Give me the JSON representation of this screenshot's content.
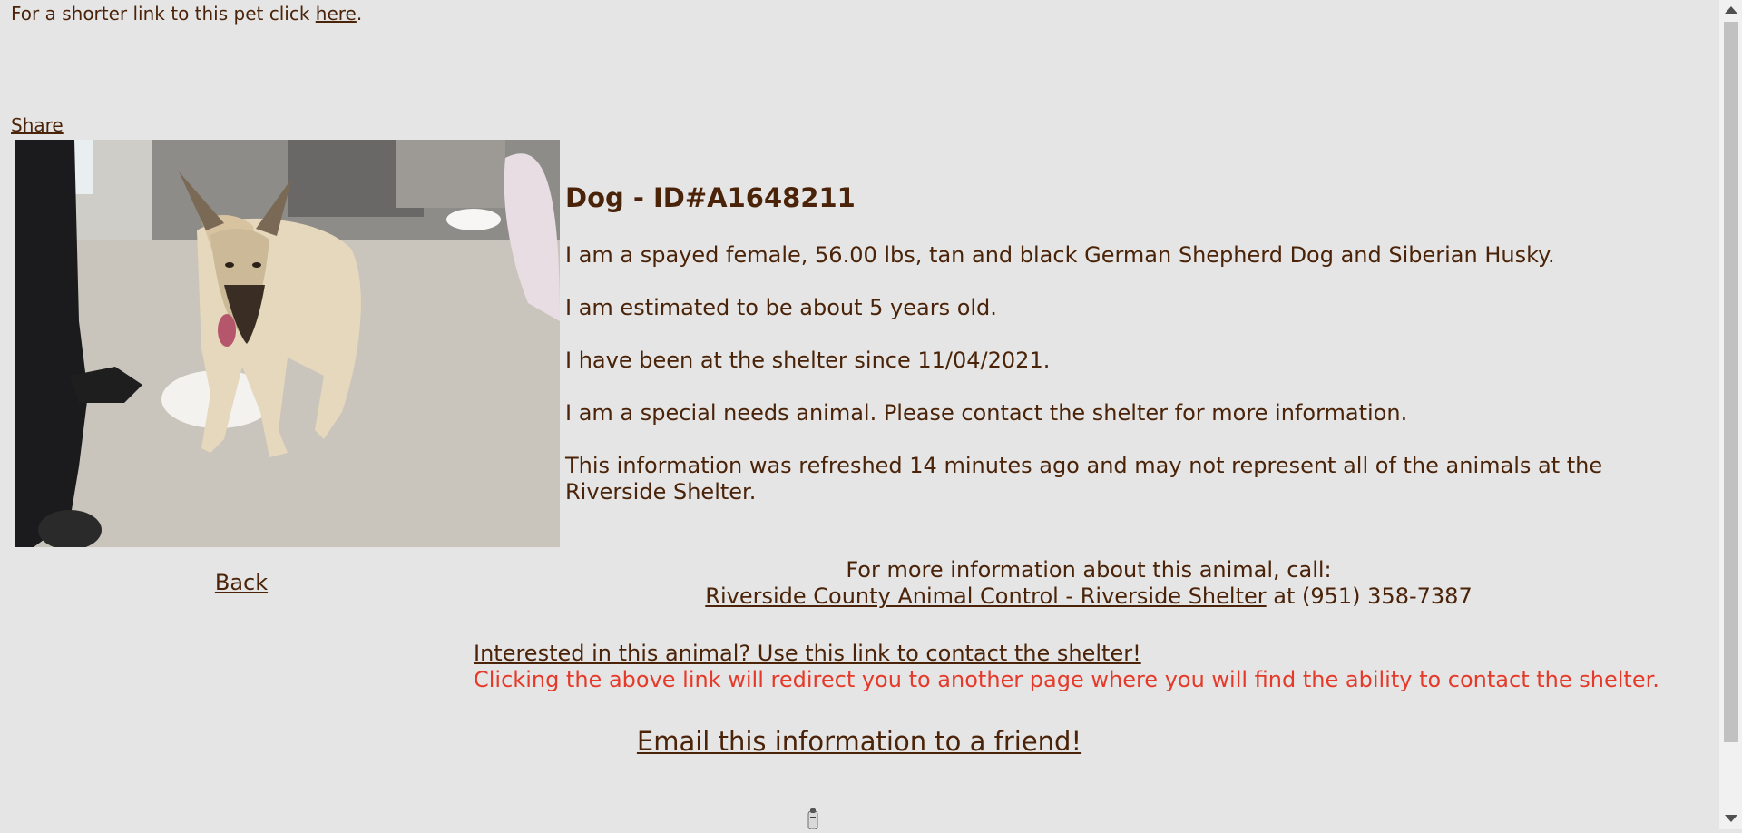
{
  "top": {
    "prefix": "For a shorter link to this pet click ",
    "link": "here",
    "suffix": "."
  },
  "share_label": "Share",
  "photo": {
    "subject": "dog",
    "alt": "Dog - ID#A1648211"
  },
  "animal": {
    "title": "Dog - ID#A1648211",
    "paragraphs": [
      "I am a spayed female, 56.00 lbs, tan and black German Shepherd Dog and Siberian Husky.",
      "I am estimated to be about 5 years old.",
      "I have been at the shelter since 11/04/2021.",
      "I am a special needs animal. Please contact the shelter for more information.",
      "This information was refreshed 14 minutes ago and may not represent all of the animals at the Riverside Shelter."
    ]
  },
  "back_label": "Back",
  "contact": {
    "line1": "For more information about this animal, call:",
    "shelter_link": "Riverside County Animal Control - Riverside Shelter",
    "phone_text": " at (951) 358-7387"
  },
  "interested": {
    "link": "Interested in this animal? Use this link to contact the shelter!",
    "warning": "Clicking the above link will redirect you to another page where you will find the ability to contact the shelter."
  },
  "email_label": "Email this information to a friend!",
  "colors": {
    "text": "#4a2308",
    "warning": "#e53a2a",
    "background": "#e5e5e5"
  }
}
